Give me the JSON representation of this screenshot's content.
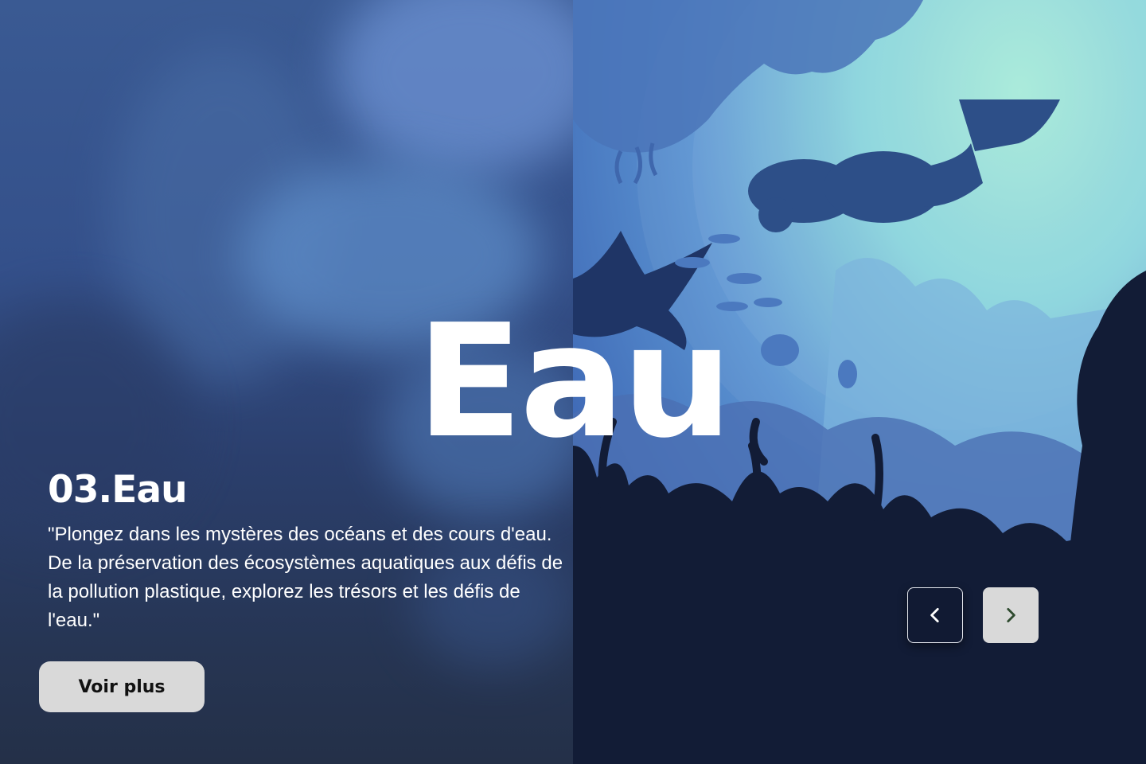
{
  "hero": {
    "title": "Eau"
  },
  "slide": {
    "heading": "03.Eau",
    "description": "\"Plongez dans les mystères des océans et des cours d'eau. De la préservation des écosystèmes aquatiques aux défis de la pollution plastique, explorez les trésors et les défis de l'eau.\"",
    "cta_label": "Voir plus"
  },
  "nav": {
    "prev_icon": "chevron-left-icon",
    "next_icon": "chevron-right-icon"
  },
  "colors": {
    "dark_navy": "#121c36",
    "button_light": "#d9d9d9",
    "text": "#ffffff"
  }
}
